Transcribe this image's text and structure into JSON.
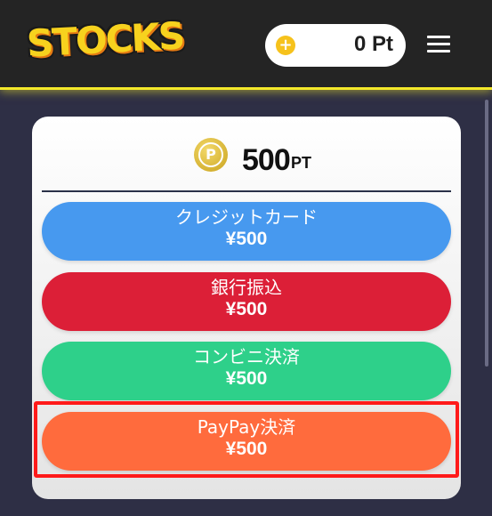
{
  "header": {
    "logo_text": "STOCKS",
    "points_icon_glyph": "+",
    "points_label": "0 Pt",
    "accent_color": "#f3e82a"
  },
  "card": {
    "coin_glyph": "P",
    "amount": "500",
    "unit": "PT"
  },
  "payment_options": [
    {
      "label": "クレジットカード",
      "price": "¥500",
      "color": "#4799ef"
    },
    {
      "label": "銀行振込",
      "price": "¥500",
      "color": "#dc1f37"
    },
    {
      "label": "コンビニ決済",
      "price": "¥500",
      "color": "#2ed08a"
    },
    {
      "label": "PayPay決済",
      "price": "¥500",
      "color": "#ff6b3d"
    }
  ],
  "highlight_color": "#ff1a1a"
}
